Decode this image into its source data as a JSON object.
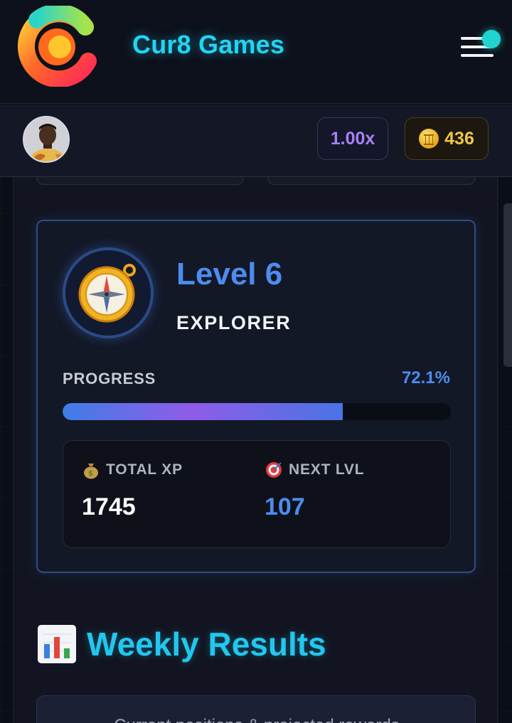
{
  "header": {
    "brand": "Cur8 Games",
    "logo_icon": "cur8-logo-icon",
    "menu_icon": "hamburger-menu-icon",
    "notification_dot_color": "#20d4d0"
  },
  "userbar": {
    "avatar_icon": "user-avatar",
    "multiplier": "1.00x",
    "coin_icon": "coin-icon",
    "coins": "436"
  },
  "level_card": {
    "badge_icon": "compass-icon",
    "level": "Level 6",
    "rank": "EXPLORER",
    "progress_label": "PROGRESS",
    "progress_text": "72.1%",
    "progress_fraction": 0.721,
    "total_xp_label": "TOTAL XP",
    "total_xp_icon": "money-bag-icon",
    "total_xp": "1745",
    "next_lvl_label": "NEXT LVL",
    "next_lvl_icon": "target-icon",
    "next_lvl": "107"
  },
  "weekly": {
    "icon": "bar-chart-icon",
    "title": "Weekly Results",
    "subtitle": "Current positions & projected rewards"
  },
  "colors": {
    "accent_cyan": "#22d4f4",
    "level_blue": "#4d8cf0",
    "multiplier_purple": "#a780f5",
    "coin_gold": "#f0c645"
  }
}
